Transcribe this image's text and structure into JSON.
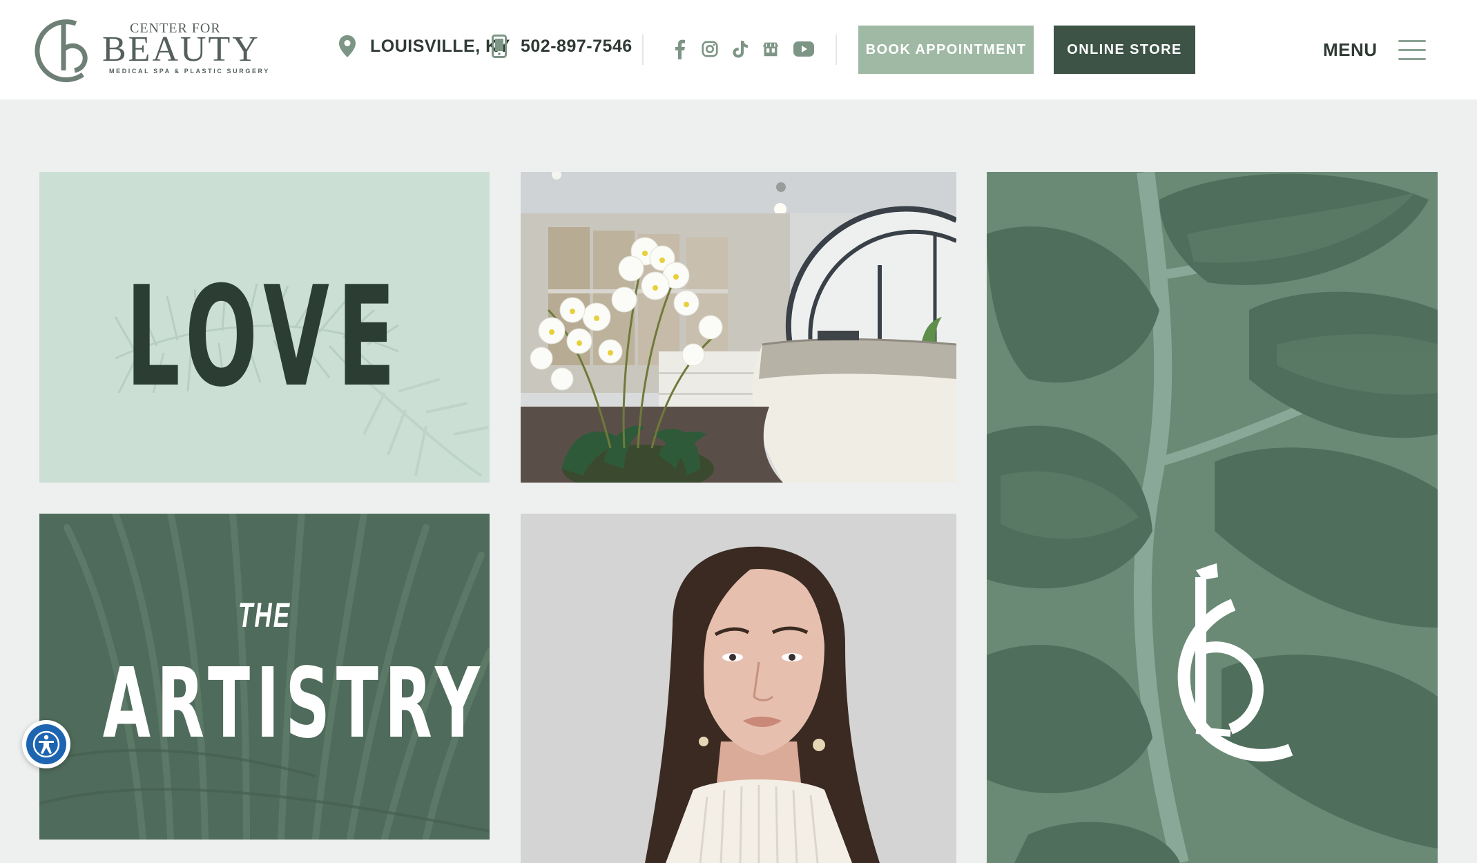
{
  "header": {
    "logo": {
      "top_text": "CENTER FOR",
      "main_text": "BEAUTY",
      "sub_text": "MEDICAL SPA & PLASTIC SURGERY",
      "icon": "cb-monogram-icon"
    },
    "location": {
      "icon": "map-pin-icon",
      "label": "LOUISVILLE, KY"
    },
    "phone": {
      "icon": "mobile-phone-icon",
      "label": "502-897-7546"
    },
    "socials": [
      {
        "name": "facebook-icon"
      },
      {
        "name": "instagram-icon"
      },
      {
        "name": "tiktok-icon"
      },
      {
        "name": "storefront-icon"
      },
      {
        "name": "youtube-icon"
      }
    ],
    "book_button": "BOOK APPOINTMENT",
    "store_button": "ONLINE STORE",
    "menu_label": "MENU",
    "menu_icon": "hamburger-icon"
  },
  "tiles": {
    "love": {
      "word": "LOVE",
      "background": "palm-leaf-pattern"
    },
    "lobby": {
      "image": "lobby-orchids-photo"
    },
    "artistry": {
      "small": "THE",
      "word": "ARTISTRY",
      "background": "palm-leaf-pattern"
    },
    "portrait": {
      "image": "woman-portrait-photo"
    },
    "leaf": {
      "image": "leaves-photo",
      "logo": "cb-monogram-icon"
    }
  },
  "accessibility": {
    "icon": "accessibility-icon"
  },
  "colors": {
    "primary_dark": "#3c5346",
    "primary_light": "#9fb9a5",
    "text_dark": "#2f3a34",
    "icon_green": "#6f8879",
    "tile_mint": "#ccdfd5",
    "tile_sage": "#4f6b5b",
    "tile_leaf": "#6b8b77",
    "page_bg": "#eef0ef"
  }
}
